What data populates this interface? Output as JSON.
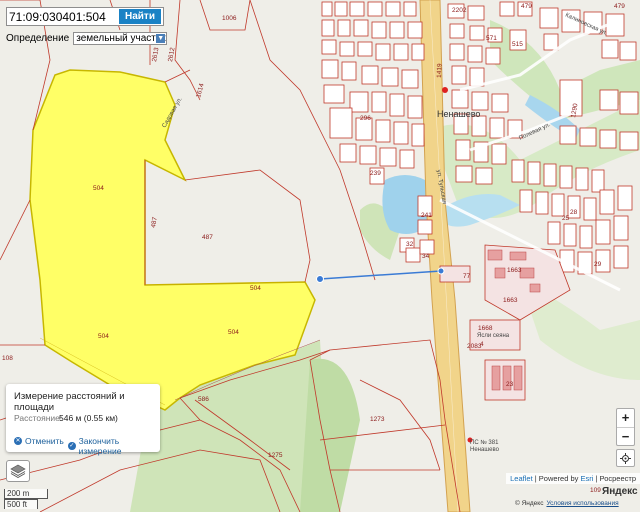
{
  "search": {
    "value": "71:09:030401:504",
    "button": "Найти"
  },
  "definition": {
    "label": "Определение",
    "selected": "земельный участок"
  },
  "measure": {
    "title": "Измерение расстояний и площади",
    "distance_label": "Расстояние:",
    "distance_value": "546 м (0.55 км)",
    "cancel": "Отменить",
    "finish": "Закончить измерение"
  },
  "zoom": {
    "in": "+",
    "out": "−"
  },
  "scale": {
    "metric": "200 m",
    "imperial": "500 ft"
  },
  "attribution": {
    "leaflet": "Leaflet",
    "sep1": " | Powered by ",
    "esri": "Esri",
    "sep2": " | Росреестр"
  },
  "yandex": {
    "logo": "Яндекс",
    "copyright": "© Яндекс",
    "terms": "Условия использования"
  },
  "place": {
    "village": "Ненашево"
  },
  "parcels": [
    "1006",
    "2613",
    "2612",
    "504",
    "487",
    "487",
    "504",
    "504",
    "504",
    "586",
    "1273",
    "1275",
    "1663",
    "1663",
    "1668",
    "2083",
    "23",
    "296",
    "239",
    "241",
    "32",
    "34",
    "77",
    "479",
    "2202",
    "571",
    "515",
    "1419",
    "1290",
    "28",
    "25",
    "29",
    "479",
    "109",
    "108",
    "1614",
    "4"
  ],
  "labels": {
    "ps": "ПС № 381",
    "ps2": "Ненашево",
    "school": "Ясли сеяна",
    "road_kalin": "Калиновская ул.",
    "road_sadov": "Садовая ул.",
    "road_polev": "Полевая ул.",
    "road_tulskaya": "ул. Тульская"
  },
  "colors": {
    "parcel_fill": "#ffff66",
    "parcel_border": "#c0392b",
    "measure_line": "#3a7bd5",
    "button": "#1a82c5"
  }
}
